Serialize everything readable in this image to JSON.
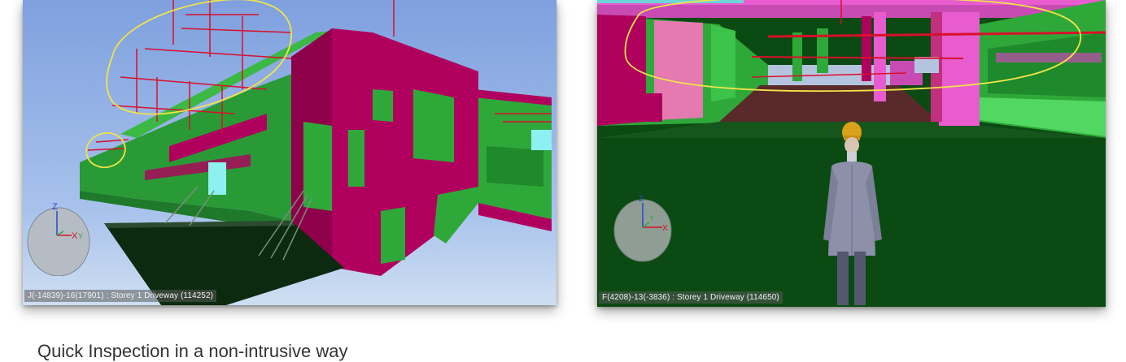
{
  "left_view": {
    "status_text": "J(-14839)-16(17901) : Storey 1 Driveway (114252)",
    "gizmo_icon": "axis-gizmo-icon",
    "axes": {
      "z": "Z",
      "x": "X",
      "y": "Y"
    }
  },
  "right_view": {
    "status_text": "F(4208)-13(-3836) : Storey 1 Driveway (114650)",
    "gizmo_icon": "axis-gizmo-icon",
    "avatar_icon": "walkthrough-avatar-icon",
    "axes": {
      "z": "Z",
      "x": "X",
      "y": "Y"
    }
  },
  "caption": "Quick Inspection in a non-intrusive way",
  "colors": {
    "sky_top": "#7e9fdd",
    "sky_bottom": "#c4d8f0",
    "magenta": "#b0005e",
    "green": "#2fa83a",
    "dark_green": "#0b4a12",
    "highlight": "#f0e44a",
    "pipe": "#d8102a"
  }
}
